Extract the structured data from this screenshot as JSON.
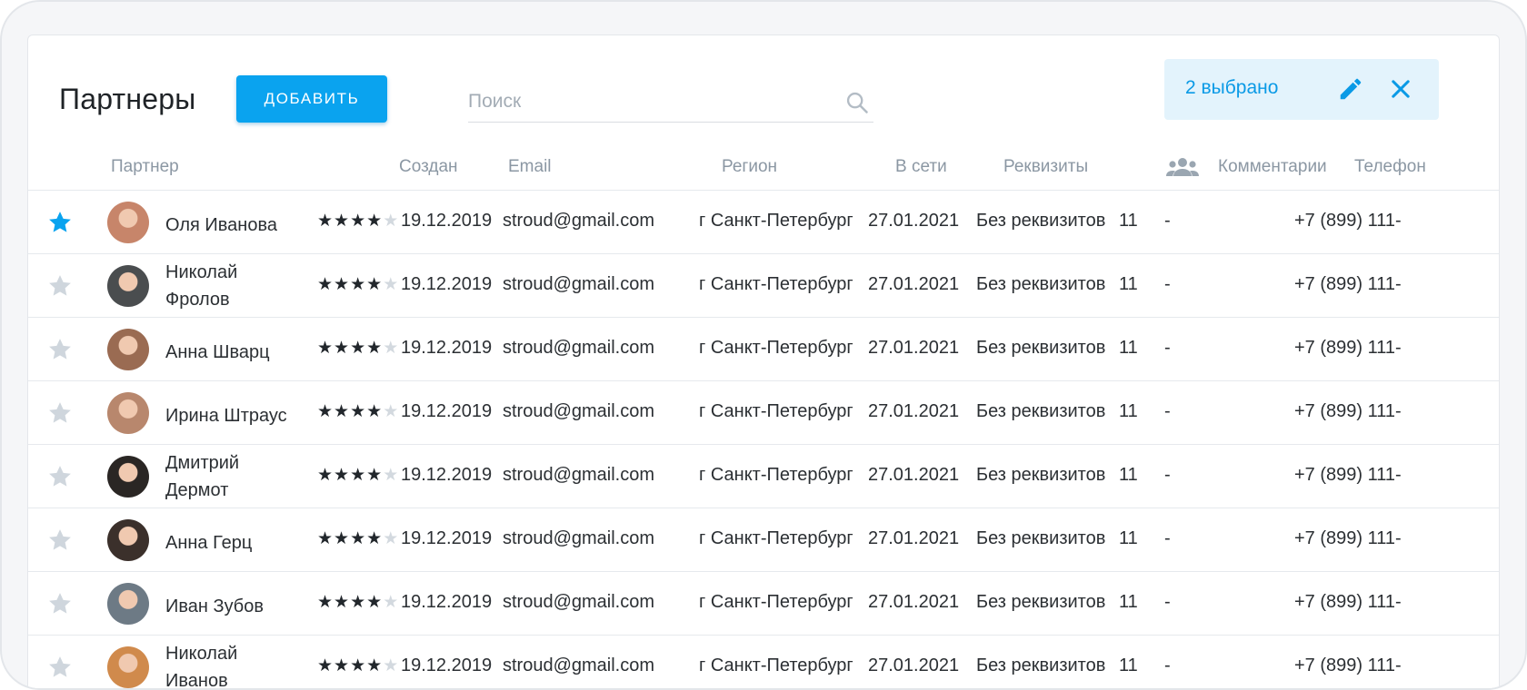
{
  "header": {
    "title": "Партнеры",
    "add_label": "ДОБАВИТЬ",
    "search_placeholder": "Поиск",
    "selection": "2 выбрано"
  },
  "colors": {
    "accent": "#0aa3ef",
    "selection_bg": "#e3f3fc",
    "star_active": "#0aa3ef",
    "star_inactive": "#cfd6dd"
  },
  "icons": {
    "search": "search-icon",
    "edit": "pencil-icon",
    "close": "close-icon",
    "group": "users-group-icon",
    "favorite": "star-icon"
  },
  "columns": {
    "partner": "Партнер",
    "created": "Создан",
    "email": "Email",
    "region": "Регион",
    "online": "В сети",
    "requisites": "Реквизиты",
    "comments": "Комментарии",
    "phone": "Телефон"
  },
  "rows": [
    {
      "favorite": true,
      "name": "Оля Иванова",
      "rating": 4,
      "created": "19.12.2019",
      "email": "stroud@gmail.com",
      "region": "г Санкт-Петербург",
      "online": "27.01.2021",
      "requisites": "Без реквизитов",
      "count": "11",
      "comment": "-",
      "phone": "+7 (899) 111-",
      "avatar_color": "#c7856a"
    },
    {
      "favorite": false,
      "name": "Николай Фролов",
      "rating": 4,
      "created": "19.12.2019",
      "email": "stroud@gmail.com",
      "region": "г Санкт-Петербург",
      "online": "27.01.2021",
      "requisites": "Без реквизитов",
      "count": "11",
      "comment": "-",
      "phone": "+7 (899) 111-",
      "avatar_color": "#4a4d4f"
    },
    {
      "favorite": false,
      "name": "Анна Шварц",
      "rating": 4,
      "created": "19.12.2019",
      "email": "stroud@gmail.com",
      "region": "г Санкт-Петербург",
      "online": "27.01.2021",
      "requisites": "Без реквизитов",
      "count": "11",
      "comment": "-",
      "phone": "+7 (899) 111-",
      "avatar_color": "#9a6b52"
    },
    {
      "favorite": false,
      "name": "Ирина Штраус",
      "rating": 4,
      "created": "19.12.2019",
      "email": "stroud@gmail.com",
      "region": "г Санкт-Петербург",
      "online": "27.01.2021",
      "requisites": "Без реквизитов",
      "count": "11",
      "comment": "-",
      "phone": "+7 (899) 111-",
      "avatar_color": "#b8876d"
    },
    {
      "favorite": false,
      "name": "Дмитрий Дермот",
      "rating": 4,
      "created": "19.12.2019",
      "email": "stroud@gmail.com",
      "region": "г Санкт-Петербург",
      "online": "27.01.2021",
      "requisites": "Без реквизитов",
      "count": "11",
      "comment": "-",
      "phone": "+7 (899) 111-",
      "avatar_color": "#2a2624"
    },
    {
      "favorite": false,
      "name": "Анна Герц",
      "rating": 4,
      "created": "19.12.2019",
      "email": "stroud@gmail.com",
      "region": "г Санкт-Петербург",
      "online": "27.01.2021",
      "requisites": "Без реквизитов",
      "count": "11",
      "comment": "-",
      "phone": "+7 (899) 111-",
      "avatar_color": "#3b302b"
    },
    {
      "favorite": false,
      "name": "Иван Зубов",
      "rating": 4,
      "created": "19.12.2019",
      "email": "stroud@gmail.com",
      "region": "г Санкт-Петербург",
      "online": "27.01.2021",
      "requisites": "Без реквизитов",
      "count": "11",
      "comment": "-",
      "phone": "+7 (899) 111-",
      "avatar_color": "#6d7a85"
    },
    {
      "favorite": false,
      "name": "Николай Иванов",
      "rating": 4,
      "created": "19.12.2019",
      "email": "stroud@gmail.com",
      "region": "г Санкт-Петербург",
      "online": "27.01.2021",
      "requisites": "Без реквизитов",
      "count": "11",
      "comment": "-",
      "phone": "+7 (899) 111-",
      "avatar_color": "#d08a4c"
    }
  ]
}
